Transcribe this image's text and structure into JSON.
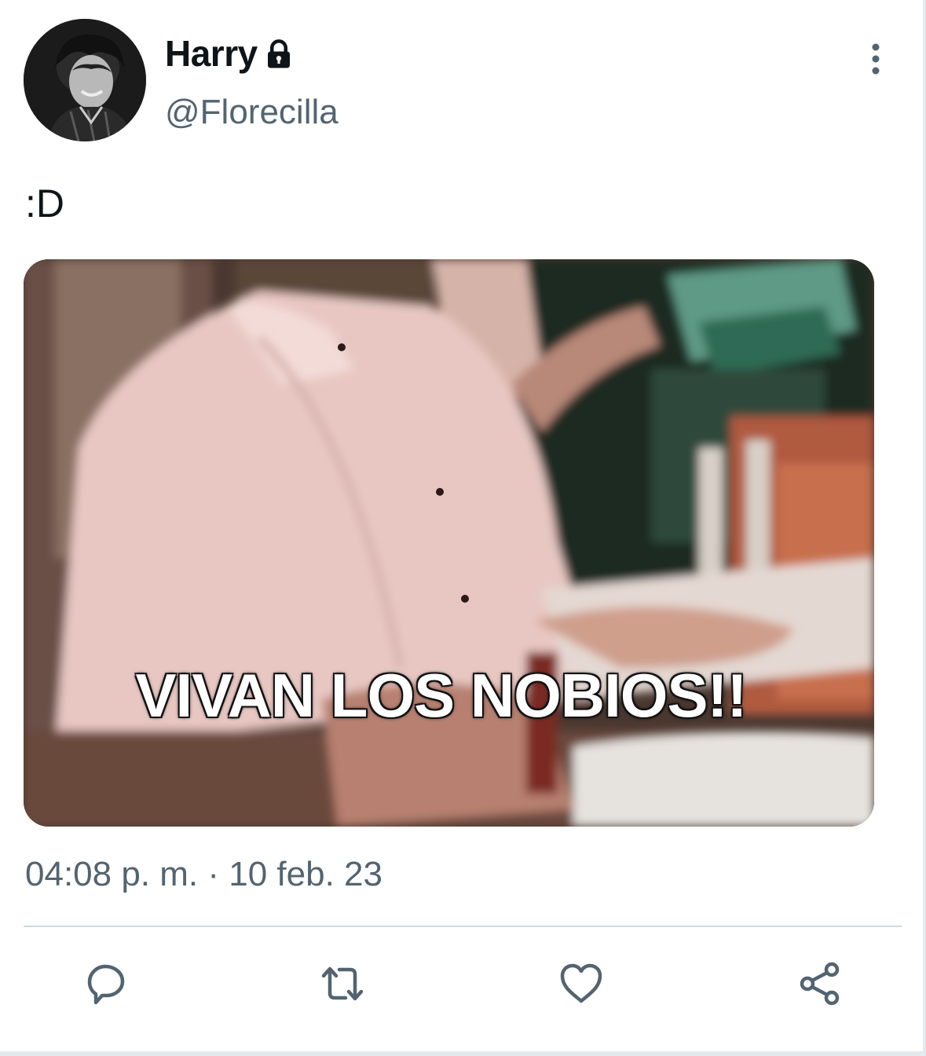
{
  "author": {
    "display_name": "Harry",
    "handle": "@Florecilla",
    "protected": true
  },
  "tweet": {
    "text": ":D",
    "media_caption": "VIVAN LOS NOBIOS!!",
    "timestamp": "04:08 p. m. · 10 feb. 23"
  },
  "icons": {
    "lock": "lock-icon",
    "more": "more-vertical-icon",
    "reply": "reply-icon",
    "retweet": "retweet-icon",
    "like": "heart-icon",
    "share": "share-icon"
  },
  "colors": {
    "text_primary": "#0f1419",
    "text_secondary": "#536471",
    "divider": "#cfd9de"
  }
}
